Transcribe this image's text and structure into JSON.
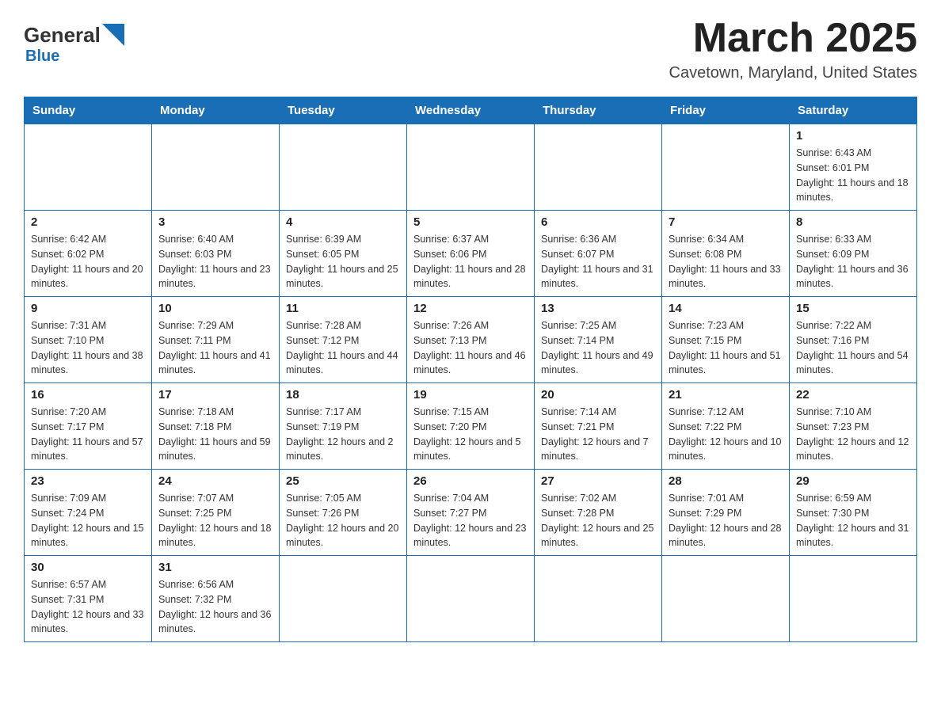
{
  "header": {
    "logo_general": "General",
    "logo_blue": "Blue",
    "month_title": "March 2025",
    "location": "Cavetown, Maryland, United States"
  },
  "weekdays": [
    "Sunday",
    "Monday",
    "Tuesday",
    "Wednesday",
    "Thursday",
    "Friday",
    "Saturday"
  ],
  "weeks": [
    [
      {
        "day": "",
        "info": ""
      },
      {
        "day": "",
        "info": ""
      },
      {
        "day": "",
        "info": ""
      },
      {
        "day": "",
        "info": ""
      },
      {
        "day": "",
        "info": ""
      },
      {
        "day": "",
        "info": ""
      },
      {
        "day": "1",
        "info": "Sunrise: 6:43 AM\nSunset: 6:01 PM\nDaylight: 11 hours and 18 minutes."
      }
    ],
    [
      {
        "day": "2",
        "info": "Sunrise: 6:42 AM\nSunset: 6:02 PM\nDaylight: 11 hours and 20 minutes."
      },
      {
        "day": "3",
        "info": "Sunrise: 6:40 AM\nSunset: 6:03 PM\nDaylight: 11 hours and 23 minutes."
      },
      {
        "day": "4",
        "info": "Sunrise: 6:39 AM\nSunset: 6:05 PM\nDaylight: 11 hours and 25 minutes."
      },
      {
        "day": "5",
        "info": "Sunrise: 6:37 AM\nSunset: 6:06 PM\nDaylight: 11 hours and 28 minutes."
      },
      {
        "day": "6",
        "info": "Sunrise: 6:36 AM\nSunset: 6:07 PM\nDaylight: 11 hours and 31 minutes."
      },
      {
        "day": "7",
        "info": "Sunrise: 6:34 AM\nSunset: 6:08 PM\nDaylight: 11 hours and 33 minutes."
      },
      {
        "day": "8",
        "info": "Sunrise: 6:33 AM\nSunset: 6:09 PM\nDaylight: 11 hours and 36 minutes."
      }
    ],
    [
      {
        "day": "9",
        "info": "Sunrise: 7:31 AM\nSunset: 7:10 PM\nDaylight: 11 hours and 38 minutes."
      },
      {
        "day": "10",
        "info": "Sunrise: 7:29 AM\nSunset: 7:11 PM\nDaylight: 11 hours and 41 minutes."
      },
      {
        "day": "11",
        "info": "Sunrise: 7:28 AM\nSunset: 7:12 PM\nDaylight: 11 hours and 44 minutes."
      },
      {
        "day": "12",
        "info": "Sunrise: 7:26 AM\nSunset: 7:13 PM\nDaylight: 11 hours and 46 minutes."
      },
      {
        "day": "13",
        "info": "Sunrise: 7:25 AM\nSunset: 7:14 PM\nDaylight: 11 hours and 49 minutes."
      },
      {
        "day": "14",
        "info": "Sunrise: 7:23 AM\nSunset: 7:15 PM\nDaylight: 11 hours and 51 minutes."
      },
      {
        "day": "15",
        "info": "Sunrise: 7:22 AM\nSunset: 7:16 PM\nDaylight: 11 hours and 54 minutes."
      }
    ],
    [
      {
        "day": "16",
        "info": "Sunrise: 7:20 AM\nSunset: 7:17 PM\nDaylight: 11 hours and 57 minutes."
      },
      {
        "day": "17",
        "info": "Sunrise: 7:18 AM\nSunset: 7:18 PM\nDaylight: 11 hours and 59 minutes."
      },
      {
        "day": "18",
        "info": "Sunrise: 7:17 AM\nSunset: 7:19 PM\nDaylight: 12 hours and 2 minutes."
      },
      {
        "day": "19",
        "info": "Sunrise: 7:15 AM\nSunset: 7:20 PM\nDaylight: 12 hours and 5 minutes."
      },
      {
        "day": "20",
        "info": "Sunrise: 7:14 AM\nSunset: 7:21 PM\nDaylight: 12 hours and 7 minutes."
      },
      {
        "day": "21",
        "info": "Sunrise: 7:12 AM\nSunset: 7:22 PM\nDaylight: 12 hours and 10 minutes."
      },
      {
        "day": "22",
        "info": "Sunrise: 7:10 AM\nSunset: 7:23 PM\nDaylight: 12 hours and 12 minutes."
      }
    ],
    [
      {
        "day": "23",
        "info": "Sunrise: 7:09 AM\nSunset: 7:24 PM\nDaylight: 12 hours and 15 minutes."
      },
      {
        "day": "24",
        "info": "Sunrise: 7:07 AM\nSunset: 7:25 PM\nDaylight: 12 hours and 18 minutes."
      },
      {
        "day": "25",
        "info": "Sunrise: 7:05 AM\nSunset: 7:26 PM\nDaylight: 12 hours and 20 minutes."
      },
      {
        "day": "26",
        "info": "Sunrise: 7:04 AM\nSunset: 7:27 PM\nDaylight: 12 hours and 23 minutes."
      },
      {
        "day": "27",
        "info": "Sunrise: 7:02 AM\nSunset: 7:28 PM\nDaylight: 12 hours and 25 minutes."
      },
      {
        "day": "28",
        "info": "Sunrise: 7:01 AM\nSunset: 7:29 PM\nDaylight: 12 hours and 28 minutes."
      },
      {
        "day": "29",
        "info": "Sunrise: 6:59 AM\nSunset: 7:30 PM\nDaylight: 12 hours and 31 minutes."
      }
    ],
    [
      {
        "day": "30",
        "info": "Sunrise: 6:57 AM\nSunset: 7:31 PM\nDaylight: 12 hours and 33 minutes."
      },
      {
        "day": "31",
        "info": "Sunrise: 6:56 AM\nSunset: 7:32 PM\nDaylight: 12 hours and 36 minutes."
      },
      {
        "day": "",
        "info": ""
      },
      {
        "day": "",
        "info": ""
      },
      {
        "day": "",
        "info": ""
      },
      {
        "day": "",
        "info": ""
      },
      {
        "day": "",
        "info": ""
      }
    ]
  ]
}
